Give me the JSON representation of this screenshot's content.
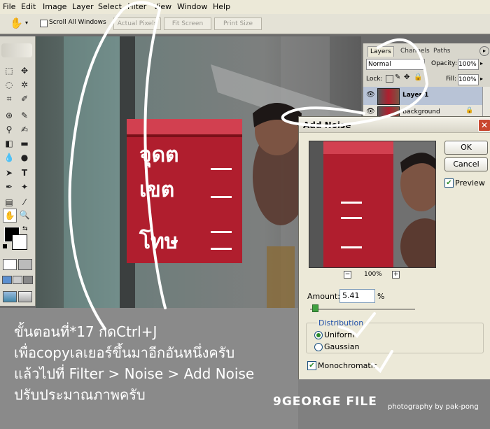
{
  "menu": {
    "items": [
      "File",
      "Edit",
      "Image",
      "Layer",
      "Select",
      "Filter",
      "View",
      "Window",
      "Help"
    ]
  },
  "options_bar": {
    "scroll_all_windows": "Scroll All Windows",
    "actual_pixels": "Actual Pixels",
    "fit_screen": "Fit Screen",
    "print_size": "Print Size"
  },
  "layers_panel": {
    "tabs": [
      "Layers",
      "Channels",
      "Paths"
    ],
    "blend_mode": "Normal",
    "opacity_label": "Opacity:",
    "opacity_value": "100%",
    "lock_label": "Lock:",
    "fill_label": "Fill:",
    "fill_value": "100%",
    "layers": [
      "Layer 1",
      "Background"
    ]
  },
  "add_noise_dialog": {
    "title": "Add Noise",
    "ok": "OK",
    "cancel": "Cancel",
    "preview": "Preview",
    "zoom": "100%",
    "zoom_out": "−",
    "zoom_in": "+",
    "amount_label": "Amount:",
    "amount_value": "5.41",
    "amount_unit": "%",
    "amount_fraction": 0.02,
    "distribution_label": "Distribution",
    "uniform": "Uniform",
    "gaussian": "Gaussian",
    "monochromatic": "Monochromatic",
    "selected_distribution": "Uniform"
  },
  "photo_sign_text": [
    "จุดต",
    "เขต",
    "โทษ"
  ],
  "caption": {
    "line1": "ขั้นตอนที่*17 กดCtrl+J",
    "line2": "เพื่อcopyเลเยอร์ขึ้นมาอีกอันหนึ่งครับ",
    "line3": "แล้วไปที่ Filter > Noise > Add Noise",
    "line4": "ปรับประมาณภาพครับ"
  },
  "footer": {
    "logo": "9GEORGE FILE",
    "credit": "photography by pak-pong"
  },
  "colors": {
    "ui_bg": "#ece9d8",
    "sign_red": "#b01e2e",
    "caption_bg": "#8a8a8a"
  }
}
